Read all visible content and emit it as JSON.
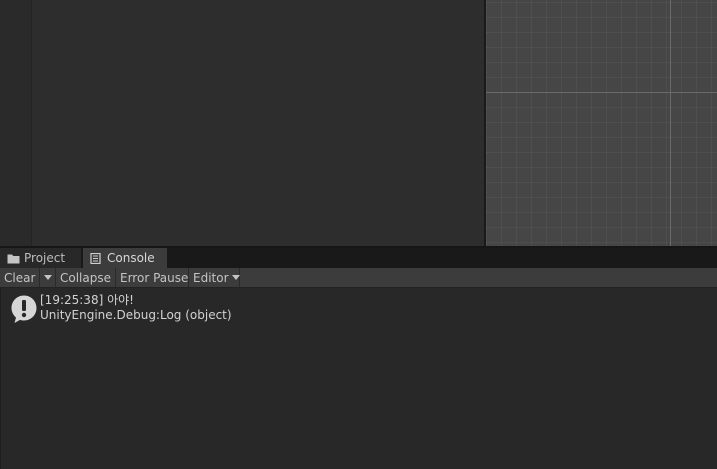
{
  "tabs": [
    {
      "label": "Project",
      "icon": "folder-icon",
      "active": false
    },
    {
      "label": "Console",
      "icon": "console-icon",
      "active": true
    }
  ],
  "toolbar": {
    "clear_label": "Clear",
    "collapse_label": "Collapse",
    "error_pause_label": "Error Pause",
    "editor_label": "Editor"
  },
  "log": {
    "entries": [
      {
        "type": "info",
        "icon": "info-message-icon",
        "message": "[19:25:38] 아야!",
        "detail": "UnityEngine.Debug:Log (object)"
      }
    ]
  },
  "colors": {
    "panel_bg": "#2d2d2d",
    "scene_bg": "#464646",
    "toolbar_bg": "#3c3c3c",
    "log_bg": "#282828",
    "text": "#d2d2d2"
  }
}
